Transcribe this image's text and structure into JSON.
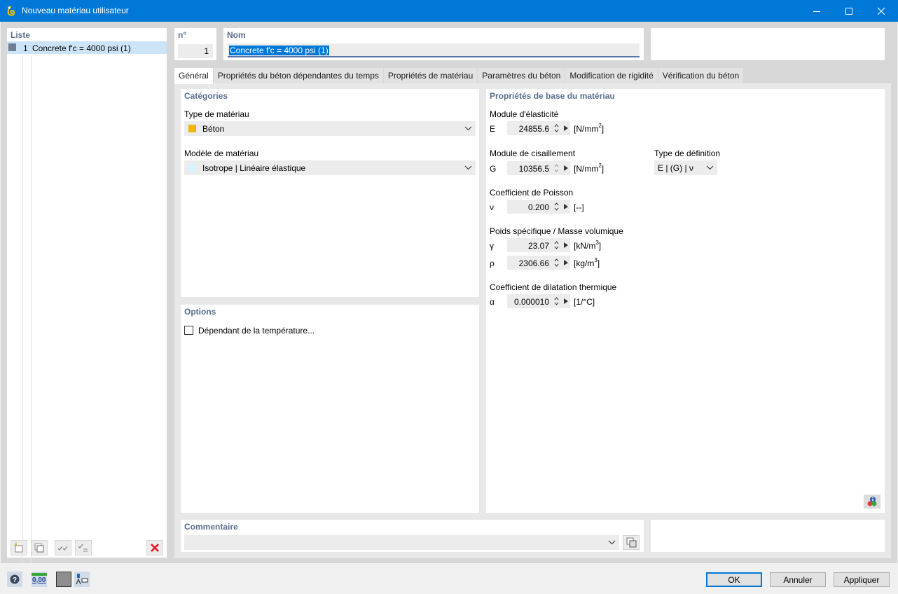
{
  "window": {
    "title": "Nouveau matériau utilisateur"
  },
  "list": {
    "title": "Liste",
    "items": [
      {
        "number": "1",
        "name": "Concrete f'c = 4000 psi (1)"
      }
    ]
  },
  "header": {
    "no_label": "n°",
    "no_value": "1",
    "name_label": "Nom",
    "name_value": "Concrete f'c = 4000 psi (1)"
  },
  "tabs": [
    {
      "label": "Général"
    },
    {
      "label": "Propriétés du béton dépendantes du temps"
    },
    {
      "label": "Propriétés de matériau"
    },
    {
      "label": "Paramètres du béton"
    },
    {
      "label": "Modification de rigidité"
    },
    {
      "label": "Vérification du béton"
    }
  ],
  "categories": {
    "title": "Catégories",
    "material_type_label": "Type de matériau",
    "material_type_value": "Béton",
    "material_type_color": "#f2b705",
    "material_model_label": "Modèle de matériau",
    "material_model_value": "Isotrope | Linéaire élastique",
    "material_model_color": "#d8f4fb"
  },
  "options": {
    "title": "Options",
    "temperature_label": "Dépendant de la température..."
  },
  "properties": {
    "title": "Propriétés de base du matériau",
    "elastic_label": "Module d'élasticité",
    "E": {
      "symbol": "E",
      "value": "24855.6",
      "unit": "[N/mm",
      "unit_sup": "2",
      "unit_end": "]"
    },
    "shear_label": "Module de cisaillement",
    "G": {
      "symbol": "G",
      "value": "10356.5",
      "unit": "[N/mm",
      "unit_sup": "2",
      "unit_end": "]"
    },
    "definition_label": "Type de définition",
    "definition_value": "E | (G) | ν",
    "poisson_label": "Coefficient de Poisson",
    "nu": {
      "symbol": "ν",
      "value": "0.200",
      "unit": "[--]"
    },
    "weight_label": "Poids spécifique / Masse volumique",
    "gamma": {
      "symbol": "γ",
      "value": "23.07",
      "unit": "[kN/m",
      "unit_sup": "3",
      "unit_end": "]"
    },
    "rho": {
      "symbol": "ρ",
      "value": "2306.66",
      "unit": "[kg/m",
      "unit_sup": "3",
      "unit_end": "]"
    },
    "thermal_label": "Coefficient de dilatation thermique",
    "alpha": {
      "symbol": "α",
      "value": "0.000010",
      "unit": "[1/°C]"
    }
  },
  "comment": {
    "title": "Commentaire"
  },
  "buttons": {
    "ok": "OK",
    "cancel": "Annuler",
    "apply": "Appliquer"
  },
  "footer": {
    "decimals_label": "0,00"
  },
  "colors": {
    "titlebar": "#0078d7",
    "selection": "#0078d7",
    "section_title": "#5a6e8c",
    "delete_red": "#e81123"
  }
}
